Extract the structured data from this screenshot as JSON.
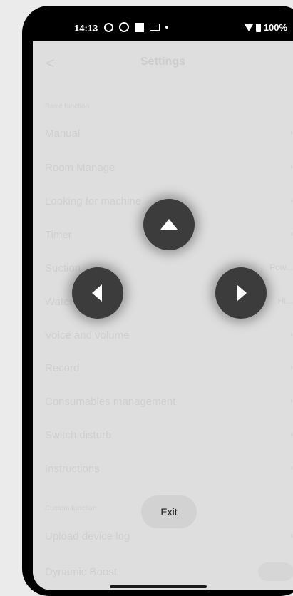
{
  "status": {
    "time": "14:13",
    "battery": "100%"
  },
  "header": {
    "back": "<",
    "title": "Settings"
  },
  "sections": {
    "basic": "Basic function",
    "custom": "Custom function"
  },
  "items": [
    {
      "label": "Manual",
      "value": "›"
    },
    {
      "label": "Room Manage",
      "value": "›"
    },
    {
      "label": "Looking for machine",
      "value": "›"
    },
    {
      "label": "Timer",
      "value": "›"
    },
    {
      "label": "Suction",
      "value": "Pow..."
    },
    {
      "label": "Water",
      "value": "Hi..."
    },
    {
      "label": "Voice and volume",
      "value": "›"
    },
    {
      "label": "Record",
      "value": "›"
    },
    {
      "label": "Consumables management",
      "value": "›"
    },
    {
      "label": "Switch disturb",
      "value": "›"
    },
    {
      "label": "Instructions",
      "value": "›"
    },
    {
      "label": "Upload device log",
      "value": "›"
    },
    {
      "label": "Dynamic Boost",
      "value": ""
    }
  ],
  "controls": {
    "up": "up-arrow",
    "left": "left-arrow",
    "right": "right-arrow"
  },
  "exit_label": "Exit"
}
